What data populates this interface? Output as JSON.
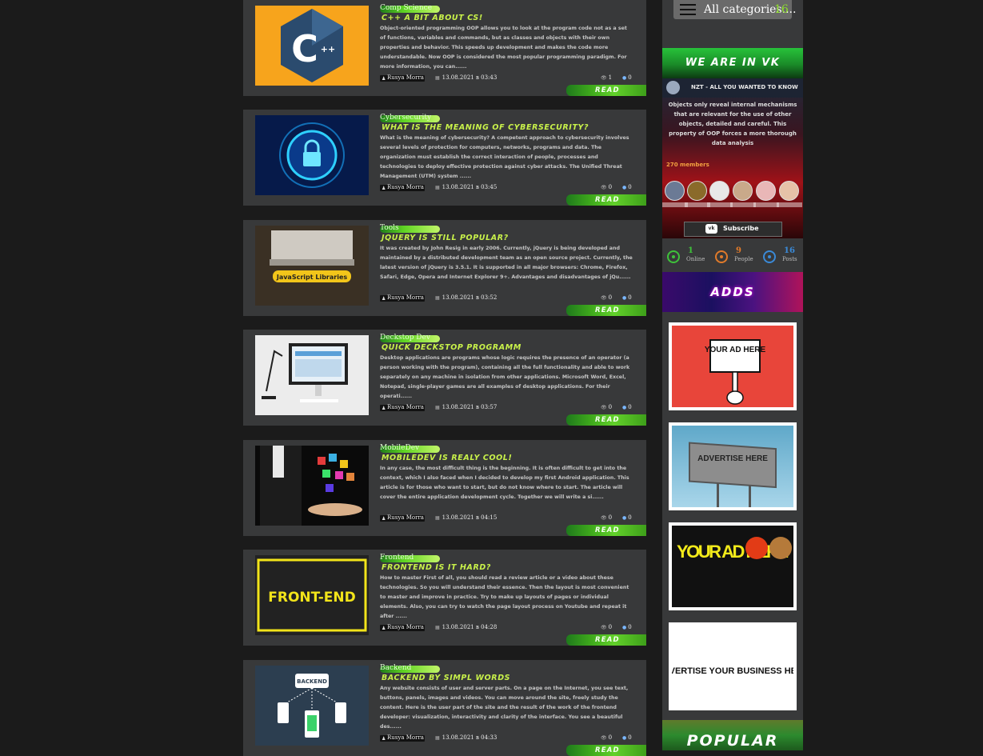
{
  "posts": [
    {
      "category": "Comp Science",
      "title": "C++ A BIT ABOUT CS!",
      "excerpt": "Object-oriented programming OOP allows you to look at the program code not as a set of functions, variables and commands, but as classes and objects with their own properties and behavior. This speeds up development and makes the code more understandable. Now OOP is considered the most popular programming paradigm. For more information, you can......",
      "author": "Rusya Morra",
      "date": "13.08.2021 в 03:43",
      "views": "1",
      "comments": "0",
      "read_label": "READ",
      "thumb": "cpp-logo"
    },
    {
      "category": "Cybersecurity",
      "title": "WHAT IS THE MEANING OF CYBERSECURITY?",
      "excerpt": "What is the meaning of cybersecurity? A competent approach to cybersecurity involves several levels of protection for computers, networks, programs and data. The organization must establish the correct interaction of people, processes and technologies to deploy effective protection against cyber attacks. The Unified Threat Management (UTM) system ......",
      "author": "Rusya Morra",
      "date": "13.08.2021 в 03:45",
      "views": "0",
      "comments": "0",
      "read_label": "READ",
      "thumb": "cyber-lock"
    },
    {
      "category": "Tools",
      "title": "JQUERY IS STILL POPULAR?",
      "excerpt": "It was created by John Resig in early 2006. Currently, jQuery is being developed and maintained by a distributed development team as an open source project. Currently, the latest version of jQuery is 3.5.1. It is supported in all major browsers: Chrome, Firefox, Safari, Edge, Opera and Internet Explorer 9+. Advantages and disadvantages of jQu......",
      "author": "Rusya Morra",
      "date": "13.08.2021 в 03:52",
      "views": "0",
      "comments": "0",
      "read_label": "READ",
      "thumb": "js-libraries",
      "thumb_text": "JavaScript Libraries"
    },
    {
      "category": "Deckstop Dev",
      "title": "QUICK DECKSTOP PROGRAMM",
      "excerpt": "Desktop applications are programs whose logic requires the presence of an operator (a person working with the program), containing all the full functionality and able to work separately on any machine in isolation from other applications. Microsoft Word, Excel, Notepad, single-player games are all examples of desktop applications. For their operati......",
      "author": "Rusya Morra",
      "date": "13.08.2021 в 03:57",
      "views": "0",
      "comments": "0",
      "read_label": "READ",
      "thumb": "desktop-monitor"
    },
    {
      "category": "MobileDev",
      "title": "MOBILEDEV IS REALY COOL!",
      "excerpt": "In any case, the most difficult thing is the beginning. It is often difficult to get into the context, which I also faced when I decided to develop my first Android application. This article is for those who want to start, but do not know where to start. The article will cover the entire application development cycle. Together we will write a si......",
      "author": "Rusya Morra",
      "date": "13.08.2021 в 04:15",
      "views": "0",
      "comments": "0",
      "read_label": "READ",
      "thumb": "mobile-apps"
    },
    {
      "category": "Frontend",
      "title": "FRONTEND IS IT HARD?",
      "excerpt": "How to master First of all, you should read a review article or a video about these technologies. So you will understand their essence. Then the layout is most convenient to master and improve in practice. Try to make up layouts of pages or individual elements. Also, you can try to watch the page layout process on Youtube and repeat it after ......",
      "author": "Rusya Morra",
      "date": "13.08.2021 в 04:28",
      "views": "0",
      "comments": "0",
      "read_label": "READ",
      "thumb": "front-end",
      "thumb_text": "FRONT-END"
    },
    {
      "category": "Backend",
      "title": "BACKEND BY SIMPL WORDS",
      "excerpt": "Any website consists of user and server parts. On a page on the Internet, you see text, buttons, panels, images and videos. You can move around the site, freely study the content. Here is the user part of the site and the result of the work of the frontend developer: visualization, interactivity and clarity of the interface. You see a beautiful des......",
      "author": "Rusya Morra",
      "date": "13.08.2021 в 04:33",
      "views": "0",
      "comments": "0",
      "read_label": "READ",
      "thumb": "backend",
      "thumb_text": "BACKEND"
    }
  ],
  "sidebar": {
    "all_categories_label": "All categories....",
    "all_categories_count": "16",
    "vk_heading": "WE ARE IN VK",
    "vk_group_name": "NZT - ALL YOU WANTED TO KNOW",
    "vk_description": "Objects only reveal internal mechanisms that are relevant for the use of other objects, detailed and careful. This property of OOP forces a more thorough data analysis",
    "vk_members": "270 members",
    "vk_subscribe": "Subscribe",
    "stats": [
      {
        "value": "1",
        "label": "Online",
        "color": "#3ec23a"
      },
      {
        "value": "9",
        "label": "People",
        "color": "#e07a2a"
      },
      {
        "value": "16",
        "label": "Posts",
        "color": "#3a8ad8"
      }
    ],
    "adds_heading": "ADDS",
    "ads": [
      {
        "text": "YOUR AD HERE",
        "style": "sign"
      },
      {
        "text": "ADVERTISE HERE",
        "style": "billboard"
      },
      {
        "text": "YOUR AD HERE",
        "style": "yellow"
      },
      {
        "text": "ADVERTISE YOUR BUSINESS HERE",
        "style": "business"
      }
    ],
    "popular_heading": "POPULAR"
  },
  "colors": {
    "accent_green": "#c9f24a",
    "card_bg": "#38393a",
    "page_bg": "#1b1b1b"
  }
}
